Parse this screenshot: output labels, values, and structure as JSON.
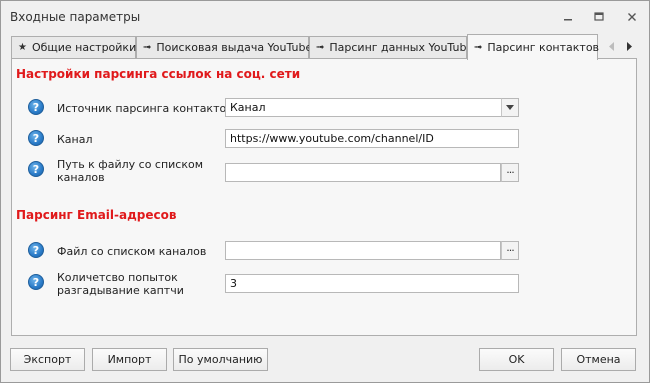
{
  "window": {
    "title": "Входные параметры"
  },
  "tabs": [
    {
      "label": "Общие настройки",
      "icon": "star-icon",
      "glyph": "★"
    },
    {
      "label": "Поисковая выдача YouTube",
      "icon": "arrow-icon",
      "glyph": "➟"
    },
    {
      "label": "Парсинг данных YouTube",
      "icon": "arrow-icon",
      "glyph": "➟"
    },
    {
      "label": "Парсинг контактов",
      "icon": "arrow-icon",
      "glyph": "➟",
      "active": true
    }
  ],
  "section1": {
    "title": "Настройки парсинга ссылок на соц. сети",
    "source": {
      "label": "Источник парсинга контактов",
      "value": "Канал"
    },
    "channel": {
      "label": "Канал",
      "value": "https://www.youtube.com/channel/ID"
    },
    "path": {
      "label_line1": "Путь к файлу со списком",
      "label_line2": "каналов",
      "value": ""
    }
  },
  "section2": {
    "title": "Парсинг Email-адресов",
    "file": {
      "label": "Файл со списком каналов",
      "value": ""
    },
    "attempts": {
      "label_line1": "Количетсво попыток",
      "label_line2": "разгадывание каптчи",
      "value": "3"
    }
  },
  "ellipsis": "···",
  "help_glyph": "?",
  "buttons": {
    "export": "Экспорт",
    "import": "Импорт",
    "default": "По умолчанию",
    "ok": "OK",
    "cancel": "Отмена"
  },
  "colors": {
    "section_title": "#e0191b",
    "help_icon": "#2a7bc8"
  }
}
